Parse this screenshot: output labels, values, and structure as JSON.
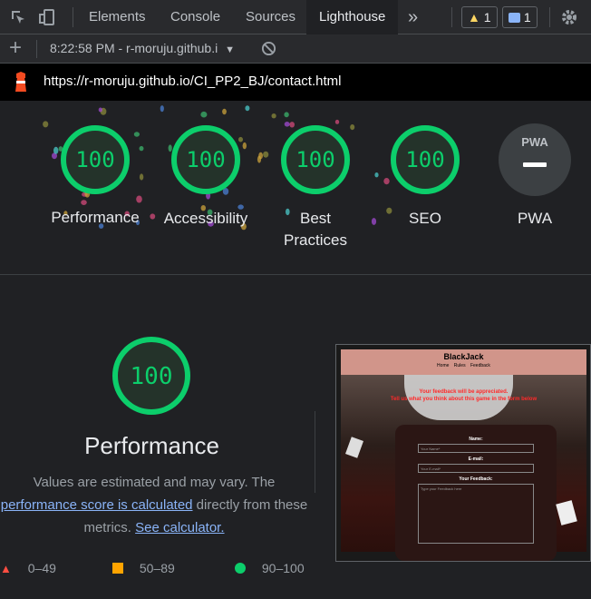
{
  "devtools": {
    "tabs": [
      "Elements",
      "Console",
      "Sources",
      "Lighthouse"
    ],
    "active_tab": "Lighthouse",
    "more": "»",
    "warnings_count": "1",
    "messages_count": "1"
  },
  "toolbar": {
    "add": "+",
    "report_selector": "8:22:58 PM - r-moruju.github.i"
  },
  "url": "https://r-moruju.github.io/CI_PP2_BJ/contact.html",
  "summary": [
    {
      "score": "100",
      "label": "Performance"
    },
    {
      "score": "100",
      "label": "Accessibility"
    },
    {
      "score": "100",
      "label": "Best Practices",
      "lines": [
        "Best",
        "Practices"
      ]
    },
    {
      "score": "100",
      "label": "SEO"
    },
    {
      "score": "PWA",
      "label": "PWA"
    }
  ],
  "performance": {
    "score": "100",
    "title": "Performance",
    "desc_1": "Values are estimated and may vary. The",
    "desc_link_1": "performance score is calculated",
    "desc_2": " directly from these",
    "desc_3": "metrics. ",
    "desc_link_2": "See calculator."
  },
  "legend": [
    {
      "range": "0–49",
      "color": "#ff4e42"
    },
    {
      "range": "50–89",
      "color": "#ffa400"
    },
    {
      "range": "90–100",
      "color": "#0cce6b"
    }
  ],
  "screenshot": {
    "site_title": "BlackJack",
    "nav": [
      "Home",
      "Rules",
      "Feedback"
    ],
    "heading_1": "Your feedback will be appreciated.",
    "heading_2": "Tell us what you think about this game in the form below",
    "name_label": "Name:",
    "name_placeholder": "Your Name*",
    "email_label": "E-mail:",
    "email_placeholder": "Your E-mail*",
    "feedback_label": "Your Feedback:",
    "feedback_placeholder": "Type your Feedback here"
  },
  "colors": {
    "pass": "#0cce6b",
    "pass_bg": "#24332a",
    "accent": "#8ab4f8"
  }
}
